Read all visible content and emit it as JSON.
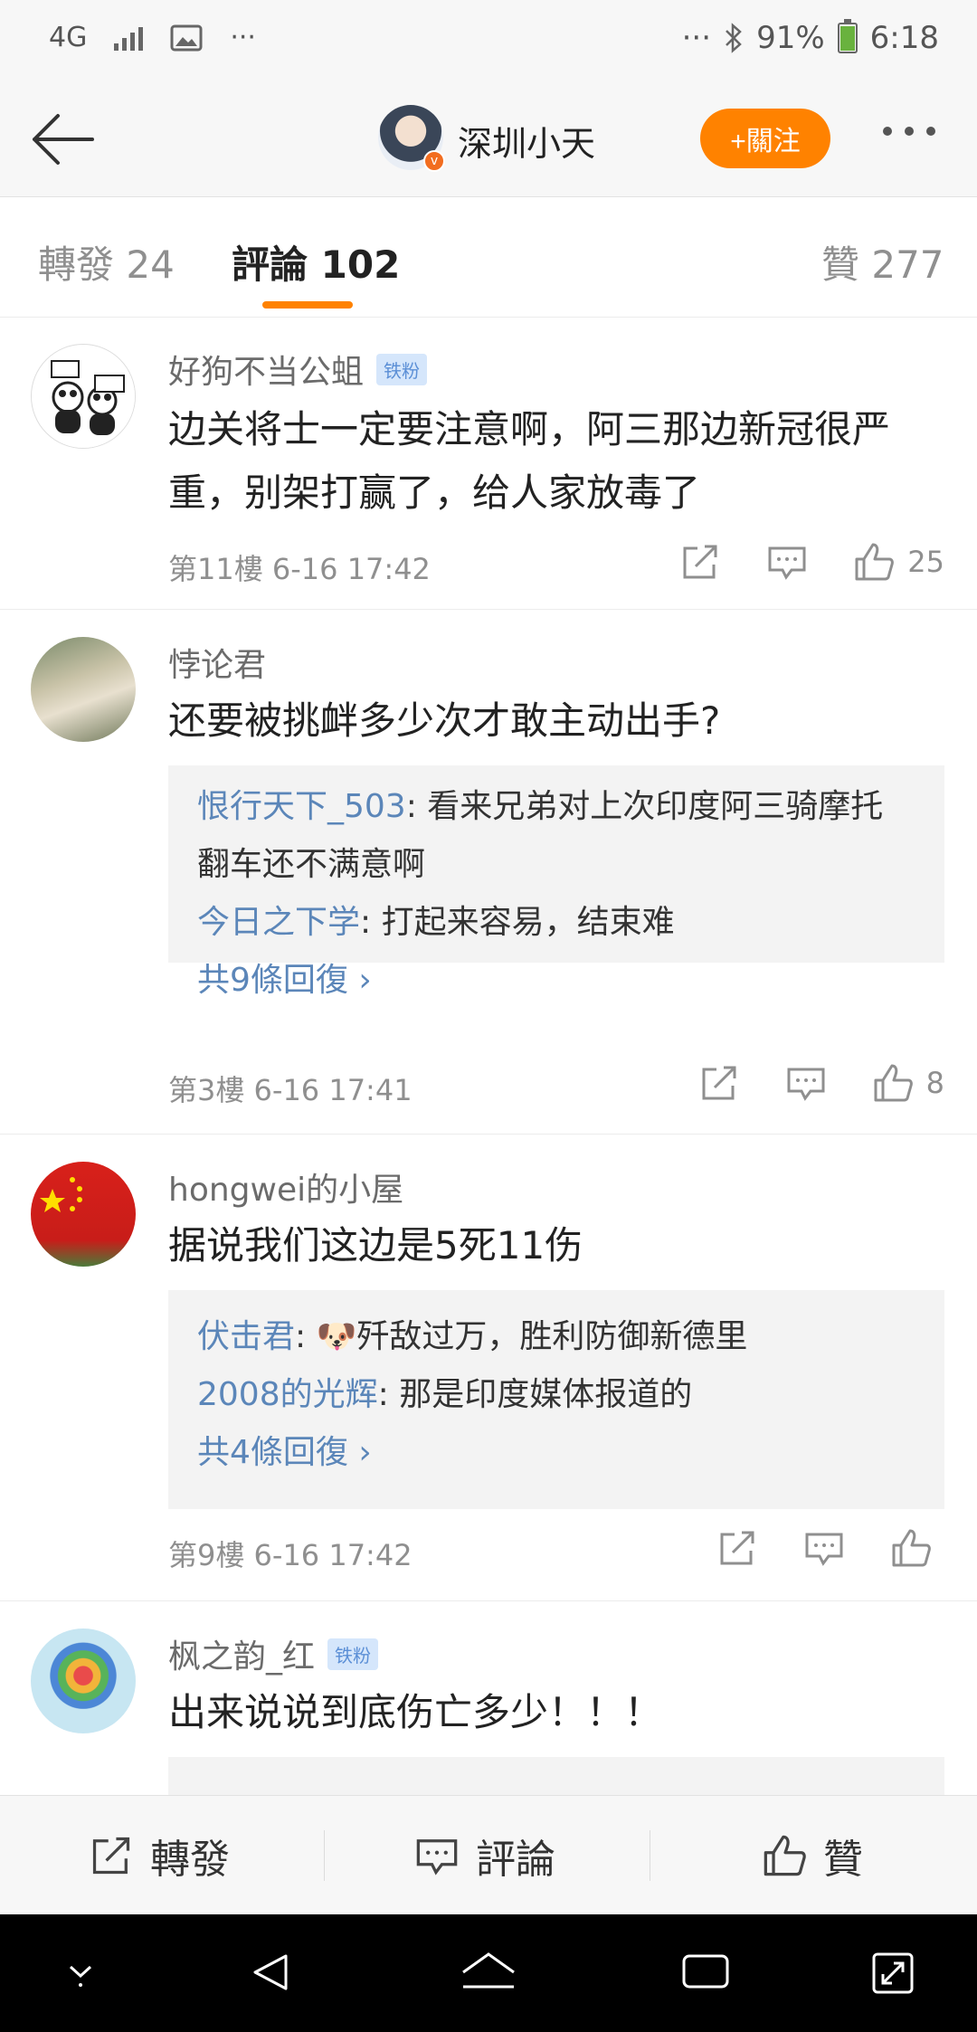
{
  "status_bar": {
    "network": "4G",
    "more": "···",
    "right_more": "···",
    "battery": "91%",
    "battery_level": 0.91,
    "time": "6:18"
  },
  "header": {
    "title": "深圳小天",
    "follow_button": "关注",
    "follow_button_full": "+關注"
  },
  "tabs": [
    {
      "label": "轉發 24",
      "active": false
    },
    {
      "label": "評論 102",
      "active": true
    },
    {
      "label": "贊 277",
      "active": false
    }
  ],
  "comments": [
    {
      "name": "好狗不当公蛆",
      "badge": "铁粉",
      "text": "边关将士一定要注意啊，阿三那边新冠很严重，别架打赢了，给人家放毒了",
      "meta": "第11樓 6-16 17:42",
      "likes": "25"
    },
    {
      "name": "悖论君",
      "text": "还要被挑衅多少次才敢主动出手?",
      "replies": [
        {
          "name": "恨行天下_503",
          "text": ": 看来兄弟对上次印度阿三骑摩托翻车还不满意啊"
        },
        {
          "name": "今日之下学",
          "text": ": 打起来容易，结束难"
        }
      ],
      "reply_more": "共9條回復 ›",
      "meta": "第3樓 6-16 17:41",
      "likes": "8"
    },
    {
      "name": "hongwei的小屋",
      "text": "据说我们这边是5死11伤",
      "replies": [
        {
          "name": "伏击君",
          "text": ": 🐶歼敌过万，胜利防御新德里"
        },
        {
          "name": "2008的光辉",
          "text": ": 那是印度媒体报道的"
        }
      ],
      "reply_more": "共4條回復 ›",
      "meta": "第9樓 6-16 17:42",
      "likes": ""
    },
    {
      "name": "枫之韵_红",
      "badge": "铁粉",
      "text": "出来说说到底伤亡多少！！！"
    }
  ],
  "bottom_bar": {
    "repost": "轉發",
    "comment": "評論",
    "like": "贊"
  },
  "colors": {
    "accent": "#ff8200",
    "link": "#5b86b9",
    "badge_bg": "#d5e6fb"
  }
}
